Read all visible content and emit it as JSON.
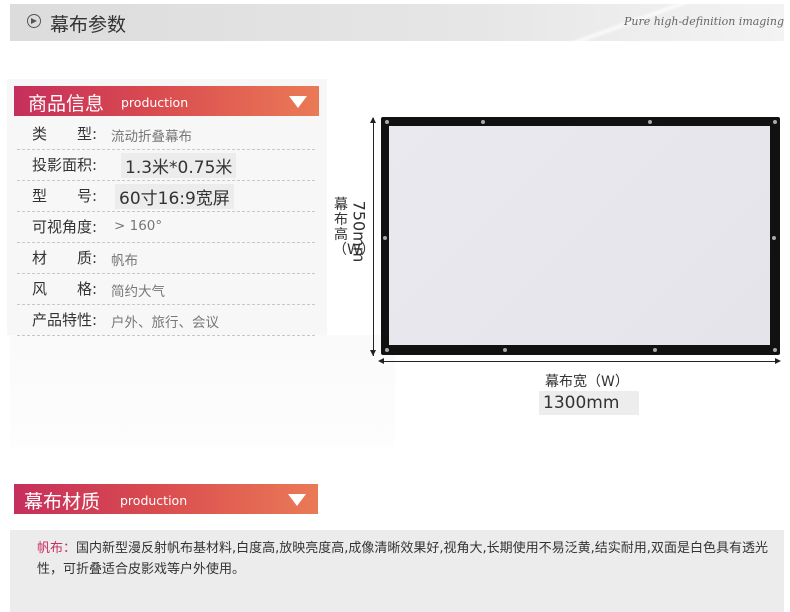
{
  "header": {
    "title": "幕布参数",
    "slogan": "Pure high-definition imaging"
  },
  "product_info": {
    "title": "商品信息",
    "subtitle": "production",
    "rows": [
      {
        "label": "类　　型:",
        "value": "流动折叠幕布"
      },
      {
        "label": "投影面积:",
        "value": "1.3米*0.75米"
      },
      {
        "label": "型　　号:",
        "value": "60寸16:9宽屏"
      },
      {
        "label": "可视角度:",
        "value": "> 160°"
      },
      {
        "label": "材　　质:",
        "value": "帆布"
      },
      {
        "label": "风　　格:",
        "value": "简约大气"
      },
      {
        "label": "产品特性:",
        "value": "户外、旅行、会议"
      }
    ]
  },
  "diagram": {
    "height_label": "幕布高（W）",
    "height_value": "750mm",
    "width_label": "幕布宽（W）",
    "width_value": "1300mm"
  },
  "material": {
    "title": "幕布材质",
    "subtitle": "production",
    "desc_lead": "帆布：",
    "desc_body": "国内新型漫反射帆布基材料,白度高,放映亮度高,成像清晰效果好,视角大,长期使用不易泛黄,结实耐用,双面是白色具有透光性，可折叠适合皮影戏等户外使用。"
  },
  "colors": {
    "accent_start": "#c62f5c",
    "accent_end": "#ea7a56",
    "screen_frame": "#111111"
  }
}
